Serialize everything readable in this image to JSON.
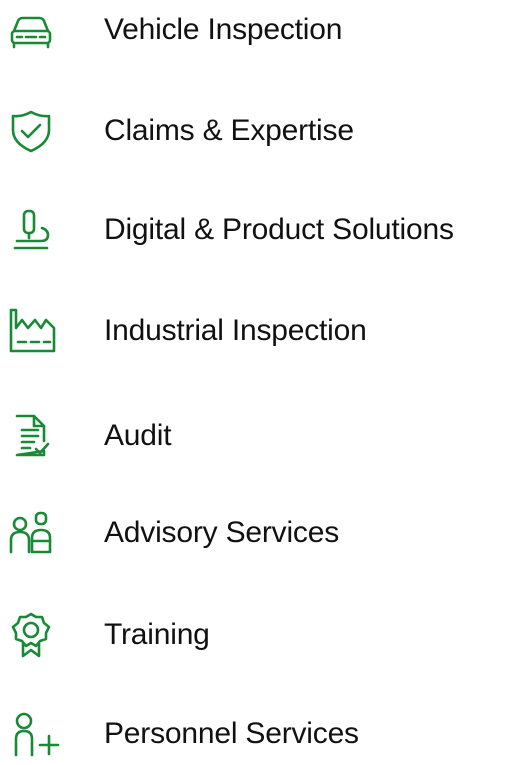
{
  "theme": {
    "accent": "#188a36",
    "text": "#111111"
  },
  "menu": {
    "items": [
      {
        "label": "Vehicle Inspection",
        "icon": "car-icon"
      },
      {
        "label": "Claims & Expertise",
        "icon": "shield-check-icon"
      },
      {
        "label": "Digital & Product Solutions",
        "icon": "microscope-icon"
      },
      {
        "label": "Industrial Inspection",
        "icon": "factory-icon"
      },
      {
        "label": "Audit",
        "icon": "document-check-icon"
      },
      {
        "label": "Advisory Services",
        "icon": "people-icon"
      },
      {
        "label": "Training",
        "icon": "award-ribbon-icon"
      },
      {
        "label": "Personnel Services",
        "icon": "person-add-icon"
      }
    ]
  }
}
